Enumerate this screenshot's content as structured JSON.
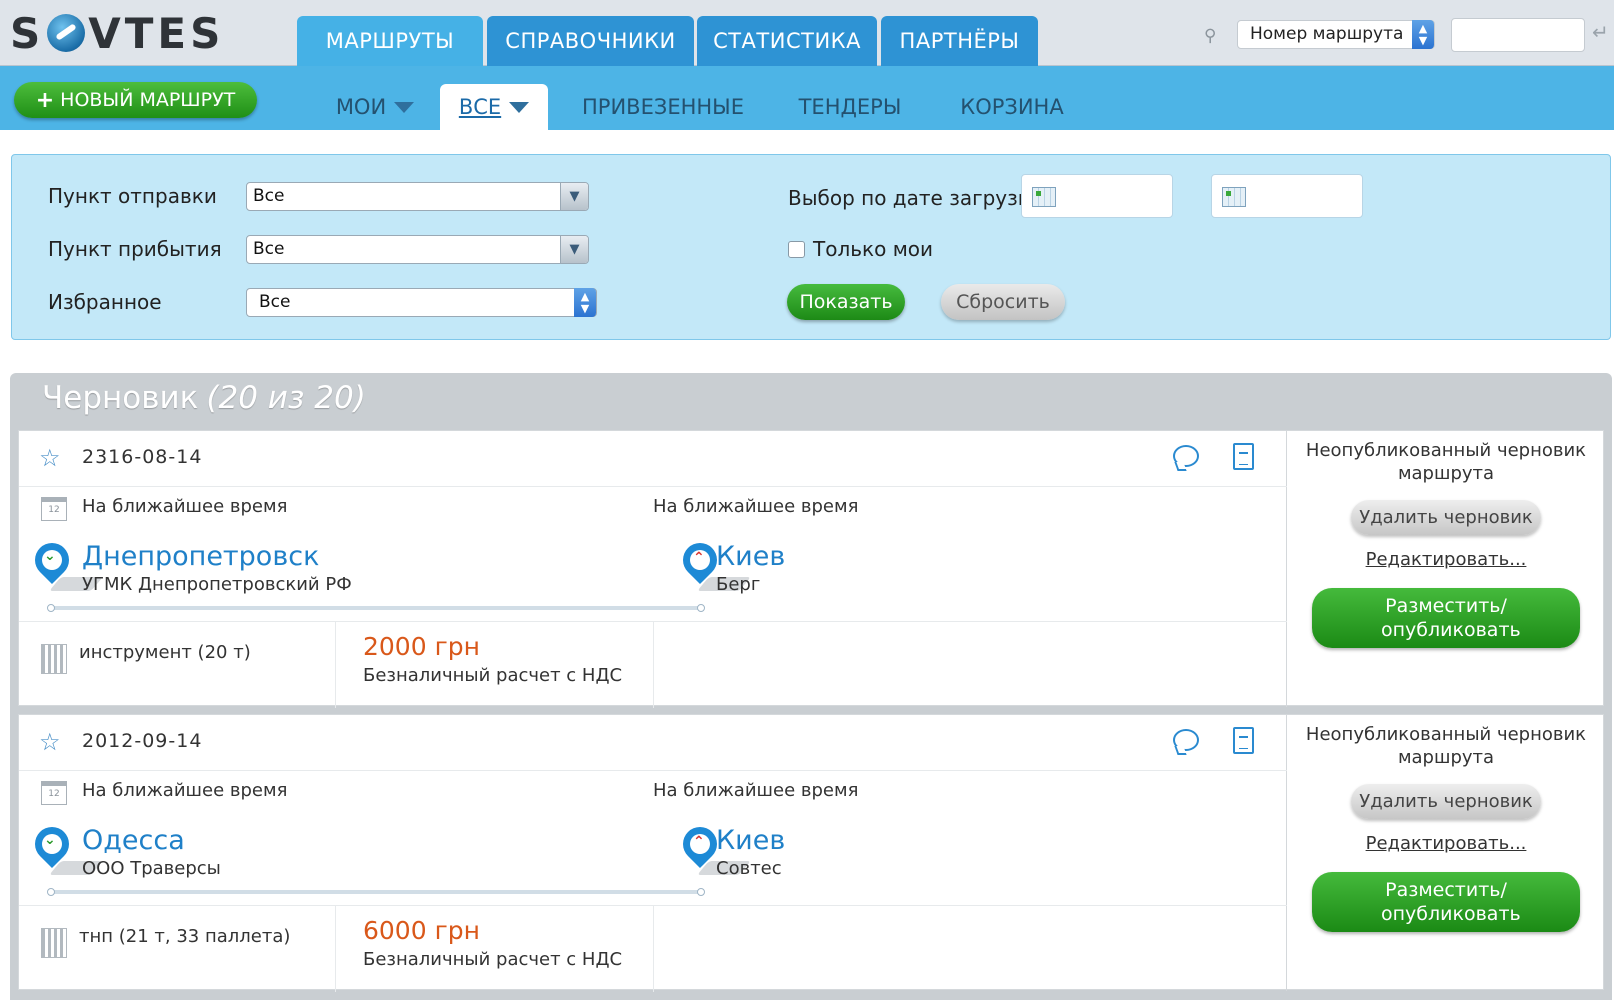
{
  "logo": {
    "text": "SOVTES"
  },
  "main_tabs": [
    {
      "label": "МАРШРУТЫ",
      "active": true
    },
    {
      "label": "СПРАВОЧНИКИ",
      "active": false
    },
    {
      "label": "СТАТИСТИКА",
      "active": false
    },
    {
      "label": "ПАРТНЁРЫ",
      "active": false
    }
  ],
  "search": {
    "selected": "Номер маршрута",
    "value": ""
  },
  "new_route_label": "НОВЫЙ МАРШРУТ",
  "sub_tabs": [
    {
      "label": "МОИ",
      "active": false
    },
    {
      "label": "ВСЕ",
      "active": true
    },
    {
      "label": "ПРИВЕЗЕННЫЕ",
      "active": false
    },
    {
      "label": "ТЕНДЕРЫ",
      "active": false
    },
    {
      "label": "КОРЗИНА",
      "active": false
    }
  ],
  "filter": {
    "origin_label": "Пункт отправки",
    "origin_value": "Все",
    "destination_label": "Пункт прибытия",
    "destination_value": "Все",
    "favorites_label": "Избранное",
    "favorites_value": "Все",
    "date_label": "Выбор по дате загрузки",
    "only_mine_label": "Только мои",
    "show_label": "Показать",
    "reset_label": "Сбросить"
  },
  "drafts": {
    "title": "Черновик",
    "count": "(20 из 20)",
    "items": [
      {
        "date": "2316-08-14",
        "from_time": "На ближайшее время",
        "to_time": "На ближайшее время",
        "from_city": "Днепропетровск",
        "from_org": "УГМК Днепропетровский РФ",
        "to_city": "Киев",
        "to_org": "Берг",
        "cargo": "инструмент (20 т)",
        "price": "2000 грн",
        "payment": "Безналичный расчет с НДС",
        "status": "Неопубликованный черновик маршрута",
        "delete_label": "Удалить черновик",
        "edit_label": "Редактировать...",
        "publish_label": "Разместить/ опубликовать"
      },
      {
        "date": "2012-09-14",
        "from_time": "На ближайшее время",
        "to_time": "На ближайшее время",
        "from_city": "Одесса",
        "from_org": "ООО Траверсы",
        "to_city": "Киев",
        "to_org": "Совтес",
        "cargo": "тнп (21 т, 33 паллета)",
        "price": "6000 грн",
        "payment": "Безналичный расчет с НДС",
        "status": "Неопубликованный черновик маршрута",
        "delete_label": "Удалить черновик",
        "edit_label": "Редактировать...",
        "publish_label": "Разместить/ опубликовать"
      }
    ]
  },
  "colors": {
    "accent": "#2e93d4",
    "subbar": "#4db4e6",
    "green": "#1f8f16",
    "price": "#d9581a"
  }
}
